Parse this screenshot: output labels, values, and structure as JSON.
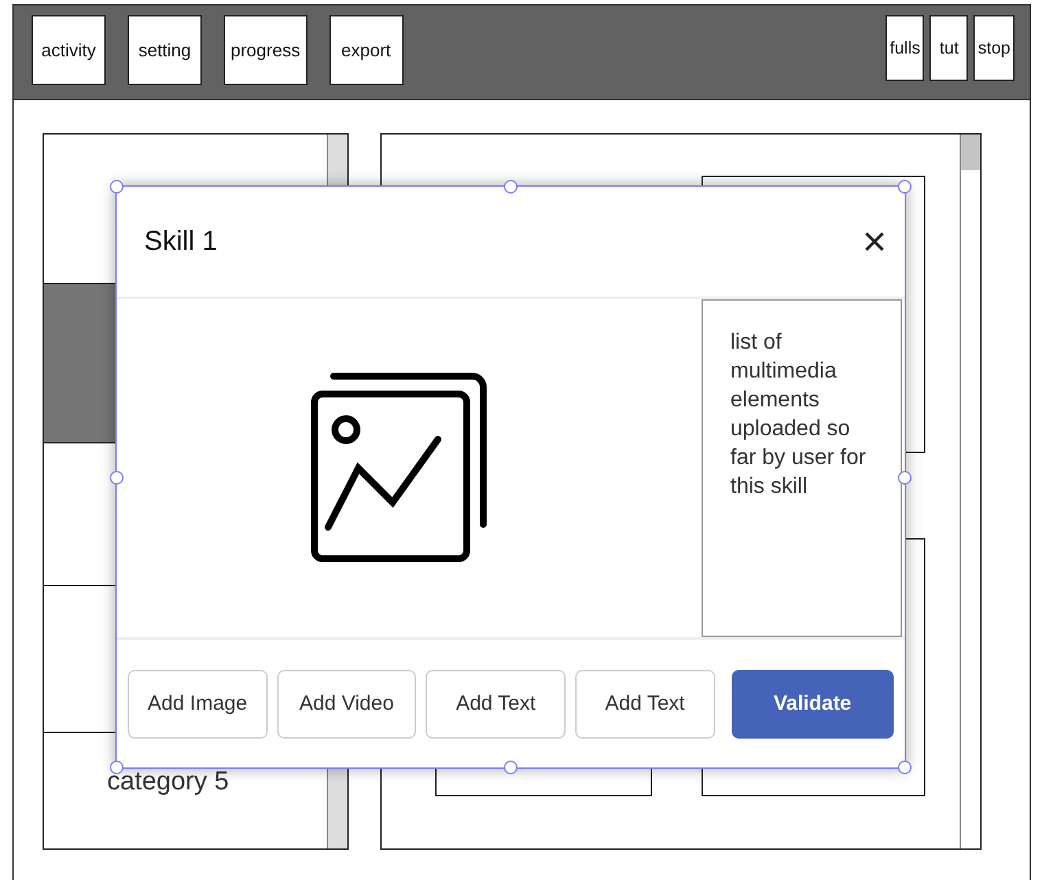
{
  "toolbar": {
    "left_buttons": [
      "activity",
      "setting",
      "progress",
      "export"
    ],
    "right_buttons": [
      "fulls",
      "tut",
      "stop"
    ]
  },
  "categories": [
    {
      "selected": false
    },
    {
      "selected": true
    },
    {
      "selected": false
    },
    {
      "selected": false
    },
    {
      "label": "category 5",
      "selected": false
    }
  ],
  "dialog": {
    "title": "Skill 1",
    "side_text": "list of multimedia elements uploaded so far by user for this skill",
    "buttons": [
      {
        "label": "Add Image",
        "kind": "secondary"
      },
      {
        "label": "Add Video",
        "kind": "secondary"
      },
      {
        "label": "Add Text",
        "kind": "secondary"
      },
      {
        "label": "Add Text",
        "kind": "secondary"
      },
      {
        "label": "Validate",
        "kind": "primary"
      }
    ]
  }
}
